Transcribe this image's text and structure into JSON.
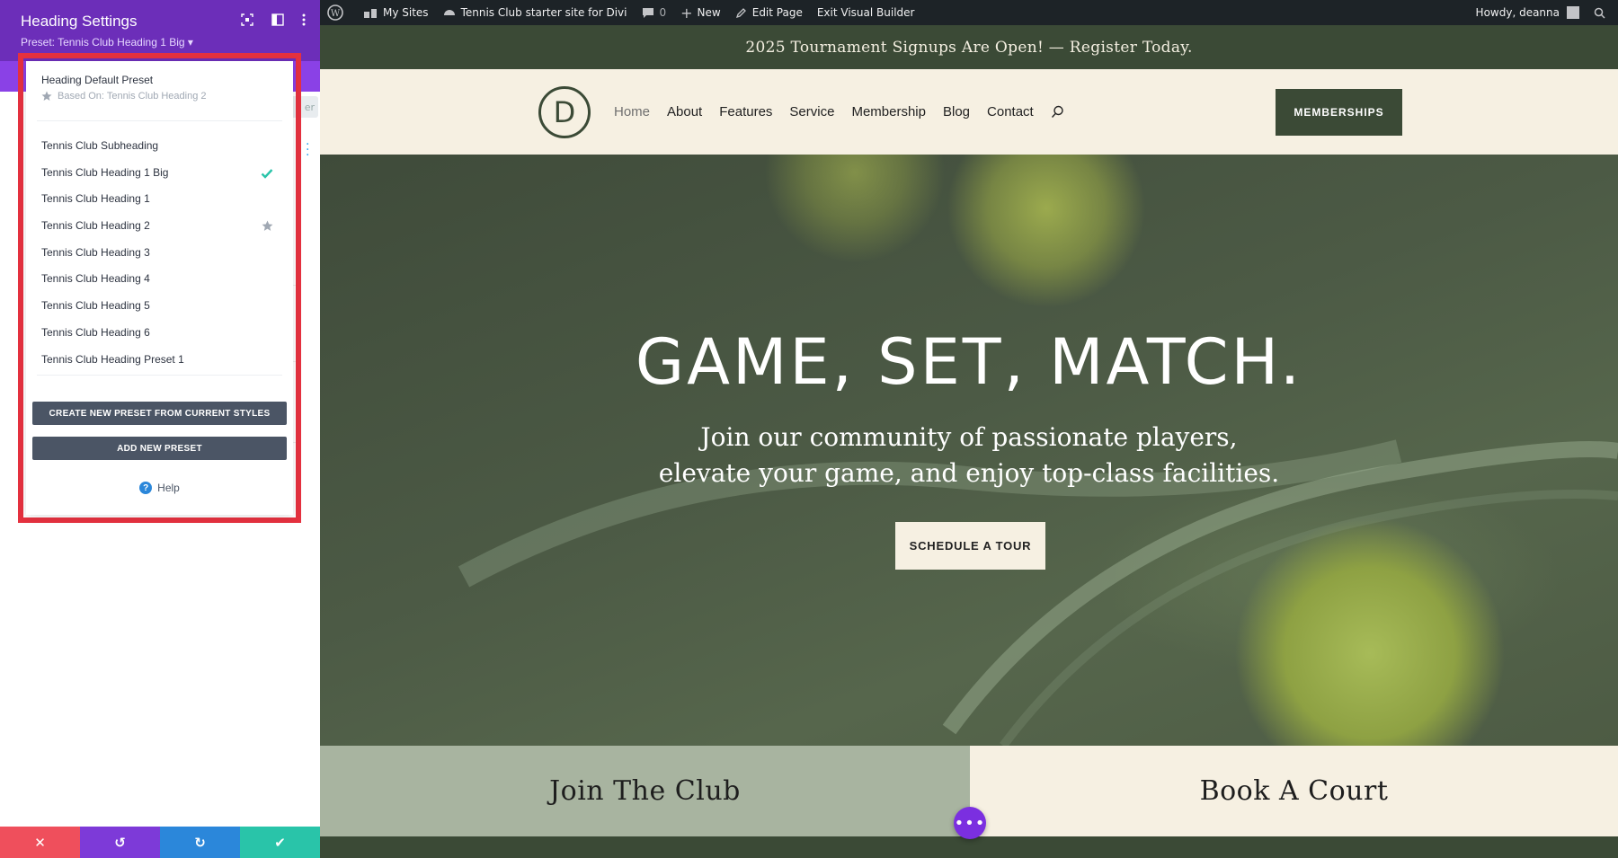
{
  "adminbar": {
    "my_sites": "My Sites",
    "site_name": "Tennis Club starter site for Divi",
    "comments_count": "0",
    "new": "New",
    "edit_page": "Edit Page",
    "exit_builder": "Exit Visual Builder",
    "howdy": "Howdy, deanna"
  },
  "announcement": "2025 Tournament Signups Are Open! — Register Today.",
  "site_header": {
    "logo_letter": "D",
    "nav": [
      "Home",
      "About",
      "Features",
      "Service",
      "Membership",
      "Blog",
      "Contact"
    ],
    "cta": "MEMBERSHIPS"
  },
  "hero": {
    "title": "GAME, SET, MATCH.",
    "subtitle_line1": "Join our community of passionate players,",
    "subtitle_line2": "elevate your game, and enjoy top-class facilities.",
    "button": "SCHEDULE A TOUR"
  },
  "cards": {
    "join": "Join The Club",
    "book": "Book A Court"
  },
  "panel": {
    "title": "Heading Settings",
    "preset_label": "Preset: Tennis Club Heading 1 Big ▾",
    "behind_chip": "er"
  },
  "dropdown": {
    "default_preset": "Heading Default Preset",
    "based_on": "Based On: Tennis Club Heading 2",
    "presets": [
      {
        "label": "Tennis Club Subheading",
        "mark": ""
      },
      {
        "label": "Tennis Club Heading 1 Big",
        "mark": "check"
      },
      {
        "label": "Tennis Club Heading 1",
        "mark": ""
      },
      {
        "label": "Tennis Club Heading 2",
        "mark": "star"
      },
      {
        "label": "Tennis Club Heading 3",
        "mark": ""
      },
      {
        "label": "Tennis Club Heading 4",
        "mark": ""
      },
      {
        "label": "Tennis Club Heading 5",
        "mark": ""
      },
      {
        "label": "Tennis Club Heading 6",
        "mark": ""
      },
      {
        "label": "Tennis Club Heading Preset 1",
        "mark": ""
      }
    ],
    "create_button": "CREATE NEW PRESET FROM CURRENT STYLES",
    "add_button": "ADD NEW PRESET",
    "help": "Help"
  },
  "colors": {
    "panel_header": "#6c2eb9",
    "highlight": "#e5313f",
    "site_green": "#3b4a36",
    "cream": "#f6f0e2"
  }
}
